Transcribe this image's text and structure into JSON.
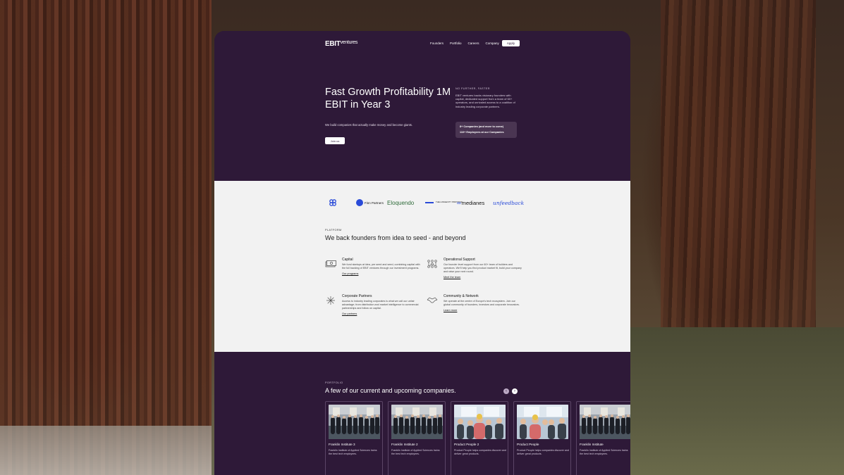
{
  "nav": {
    "logo_main": "EBIT",
    "logo_sub": "ventures",
    "links": [
      "Founders",
      "Portfolio",
      "Careers",
      "Company"
    ],
    "apply": "Apply"
  },
  "hero": {
    "title": "Fast Growth Profitability 1M EBIT in Year 3",
    "subtitle": "We build companies that actually make money and become giants.",
    "cta": "Join us",
    "eyebrow": "NO FURTHER, FASTER",
    "description": "EBIT ventures backs visionary founders with capital, dedicated support from a team of 60+ operators, and unrivaled access to a coalition of industry leading corporate partners.",
    "stats": [
      "8+ Companies (and more to come)",
      "110+ Employees at our Companies"
    ]
  },
  "partner_logos": [
    "Finn Partners",
    "Eloquendo",
    "THE LONGEVITY PROTOCOL",
    "medianes",
    "unfeedback"
  ],
  "platform": {
    "eyebrow": "PLATFORM",
    "title": "We back founders from idea to seed - and beyond",
    "features": [
      {
        "title": "Capital",
        "text": "We fund startups at idea, pre seed and seed, combining capital with the full backing of EBIT ventures through our investment programs.",
        "link": "Our programs",
        "icon": "cash-icon"
      },
      {
        "title": "Operational Support",
        "text": "Our founder level support from our 60+ team of builders and operators. We'll help you find product market fit, build your company and raise your next round.",
        "link": "Meet the team",
        "icon": "network-icon"
      },
      {
        "title": "Corporate Partners",
        "text": "Access to industry leading corporates is what we call our unfair advantage; from distribution and market intelligence to commercial partnerships and follow on capital.",
        "link": "Our partners",
        "icon": "sparkle-icon"
      },
      {
        "title": "Community & Network",
        "text": "We operate at the centre of Europe's tech ecosystem. Join our global community of founders, investors and corporate innovators.",
        "link": "Learn more",
        "icon": "handshake-icon"
      }
    ]
  },
  "portfolio": {
    "eyebrow": "PORTFOLIO",
    "title": "A few of our current and upcoming companies.",
    "prev": "‹",
    "next": "›",
    "cards": [
      {
        "name": "Franklin Institute 3",
        "text": "Franklin Institute of Applied Sciences trains the best tech employees."
      },
      {
        "name": "Franklin Institute 2",
        "text": "Franklin Institute of Applied Sciences trains the best tech employees."
      },
      {
        "name": "Product People 2",
        "text": "Product People helps companies discover and deliver great products."
      },
      {
        "name": "Product People",
        "text": "Product People helps companies discover and deliver great products."
      },
      {
        "name": "Franklin Institute",
        "text": "Franklin Institute of Applied Sciences trains the best tech employees."
      }
    ]
  },
  "colors": {
    "primary": "#2e1938",
    "light_section": "#f2f2f2",
    "accent_blue": "#2a4bd8"
  }
}
